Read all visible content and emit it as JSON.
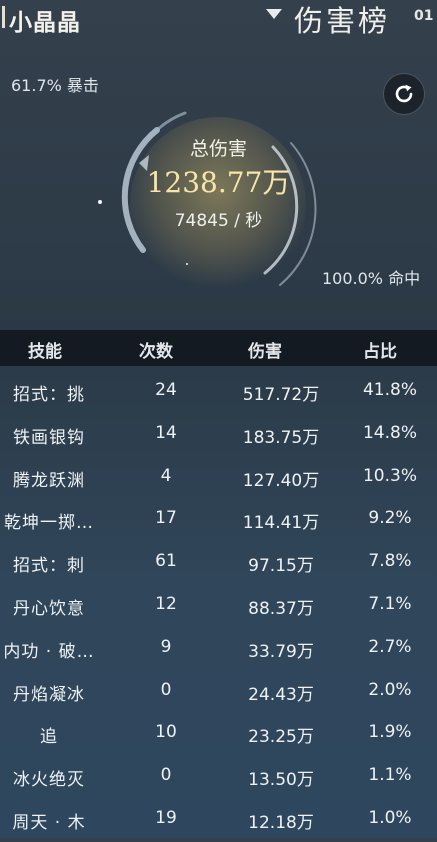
{
  "header": {
    "player_name": "小晶晶",
    "board_title": "伤害榜",
    "board_index": "01"
  },
  "summary": {
    "crit": "61.7% 暴击",
    "hit": "100.0% 命中",
    "total_label": "总伤害",
    "total_value": "1238.77万",
    "dps": "74845 / 秒",
    "icons": {
      "refresh": "refresh-icon",
      "dropdown": "triangle-down-icon"
    }
  },
  "table": {
    "headers": [
      "技能",
      "次数",
      "伤害",
      "占比"
    ],
    "rows": [
      {
        "skill": "招式：挑",
        "count": "24",
        "damage": "517.72万",
        "pct": "41.8%"
      },
      {
        "skill": "铁画银钩",
        "count": "14",
        "damage": "183.75万",
        "pct": "14.8%"
      },
      {
        "skill": "腾龙跃渊",
        "count": "4",
        "damage": "127.40万",
        "pct": "10.3%"
      },
      {
        "skill": "乾坤一掷…",
        "count": "17",
        "damage": "114.41万",
        "pct": "9.2%"
      },
      {
        "skill": "招式：刺",
        "count": "61",
        "damage": "97.15万",
        "pct": "7.8%"
      },
      {
        "skill": "丹心饮意",
        "count": "12",
        "damage": "88.37万",
        "pct": "7.1%"
      },
      {
        "skill": "内功 · 破…",
        "count": "9",
        "damage": "33.79万",
        "pct": "2.7%"
      },
      {
        "skill": "丹焰凝冰",
        "count": "0",
        "damage": "24.43万",
        "pct": "2.0%"
      },
      {
        "skill": "追",
        "count": "10",
        "damage": "23.25万",
        "pct": "1.9%"
      },
      {
        "skill": "冰火绝灭",
        "count": "0",
        "damage": "13.50万",
        "pct": "1.1%"
      },
      {
        "skill": "周天 · 木",
        "count": "19",
        "damage": "12.18万",
        "pct": "1.0%"
      }
    ]
  },
  "colors": {
    "accent_gold": "#f7e6a8",
    "header_bg": "#12181e",
    "ring": "#b9c7d3"
  }
}
